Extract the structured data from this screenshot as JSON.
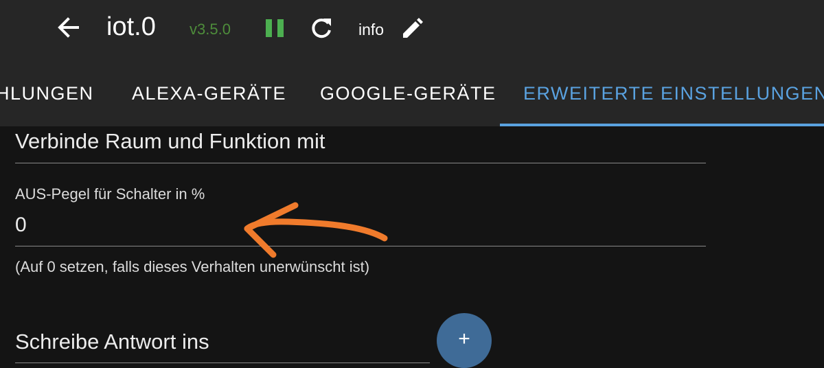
{
  "header": {
    "title": "iot.0",
    "version": "v3.5.0",
    "info_label": "info",
    "icons": [
      "back-arrow-icon",
      "pause-icon",
      "reload-icon",
      "pencil-icon"
    ],
    "colors": {
      "version": "#4e8d3b",
      "pause": "#4caf50"
    }
  },
  "tabs": [
    {
      "label": "HLUNGEN",
      "active": false
    },
    {
      "label": "ALEXA-GERÄTE",
      "active": false
    },
    {
      "label": "GOOGLE-GERÄTE",
      "active": false
    },
    {
      "label": "ERWEITERTE EINSTELLUNGEN",
      "active": true
    }
  ],
  "accent_color": "#5aa2e0",
  "form": {
    "room_function_field": "Verbinde Raum und Funktion mit",
    "off_level_label": "AUS-Pegel für Schalter in %",
    "off_level_value": "0",
    "off_level_helper": "(Auf 0 setzen, falls dieses Verhalten unerwünscht ist)",
    "response_field": "Schreibe Antwort ins"
  },
  "fab": {
    "label": "+",
    "color": "#3f6b97"
  },
  "annotation": {
    "color": "#f07b2c"
  }
}
